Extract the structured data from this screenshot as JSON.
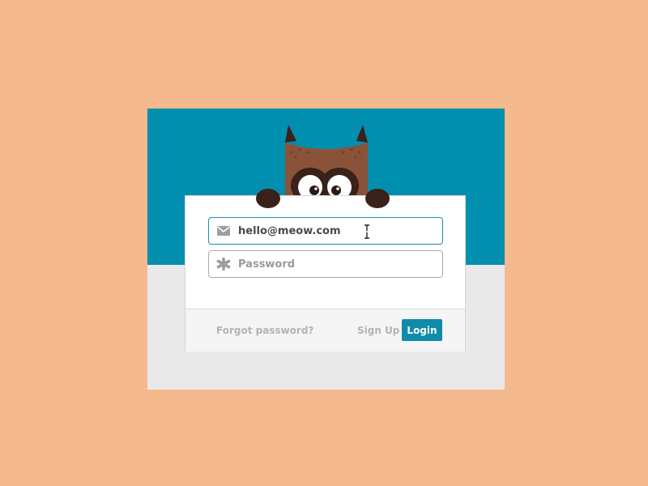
{
  "login_form": {
    "email": {
      "value": "hello@meow.com",
      "icon": "envelope-icon"
    },
    "password": {
      "placeholder": "Password",
      "icon": "asterisk-icon"
    },
    "forgot_password_label": "Forgot password?",
    "signup_label": "Sign Up",
    "login_label": "Login"
  },
  "mascot": {
    "icon": "owl-icon"
  },
  "colors": {
    "page_background": "#f4b98d",
    "header_band": "#018faf",
    "lower_panel": "#e9e9e9",
    "owl_body": "#8a5339",
    "owl_feet": "#3a2119",
    "owl_beak": "#f5c51b",
    "accent": "#0f8ba9",
    "link_text": "#b3b3b3"
  }
}
